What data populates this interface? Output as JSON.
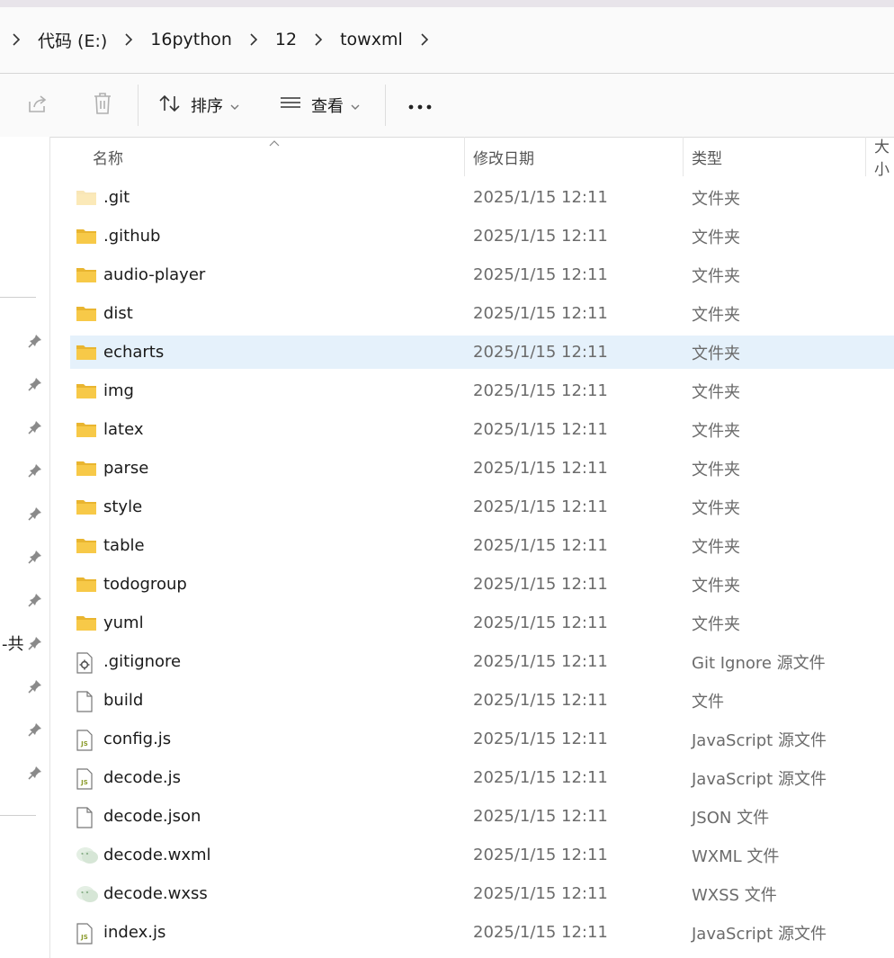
{
  "breadcrumb": {
    "items": [
      {
        "label": "代码 (E:)"
      },
      {
        "label": "16python"
      },
      {
        "label": "12"
      },
      {
        "label": "towxml"
      }
    ]
  },
  "toolbar": {
    "share_icon": "share-icon",
    "delete_icon": "trash-icon",
    "sort_label": "排序",
    "view_label": "查看",
    "more_icon": "more-icon"
  },
  "left_nav": {
    "partial_text": "-共",
    "pin_count": 11
  },
  "columns": {
    "name": "名称",
    "modified": "修改日期",
    "type": "类型",
    "size": "大小"
  },
  "files": [
    {
      "name": ".git",
      "date": "2025/1/15 12:11",
      "type": "文件夹",
      "icon": "folder-hidden"
    },
    {
      "name": ".github",
      "date": "2025/1/15 12:11",
      "type": "文件夹",
      "icon": "folder"
    },
    {
      "name": "audio-player",
      "date": "2025/1/15 12:11",
      "type": "文件夹",
      "icon": "folder"
    },
    {
      "name": "dist",
      "date": "2025/1/15 12:11",
      "type": "文件夹",
      "icon": "folder"
    },
    {
      "name": "echarts",
      "date": "2025/1/15 12:11",
      "type": "文件夹",
      "icon": "folder",
      "selected": true
    },
    {
      "name": "img",
      "date": "2025/1/15 12:11",
      "type": "文件夹",
      "icon": "folder"
    },
    {
      "name": "latex",
      "date": "2025/1/15 12:11",
      "type": "文件夹",
      "icon": "folder"
    },
    {
      "name": "parse",
      "date": "2025/1/15 12:11",
      "type": "文件夹",
      "icon": "folder"
    },
    {
      "name": "style",
      "date": "2025/1/15 12:11",
      "type": "文件夹",
      "icon": "folder"
    },
    {
      "name": "table",
      "date": "2025/1/15 12:11",
      "type": "文件夹",
      "icon": "folder"
    },
    {
      "name": "todogroup",
      "date": "2025/1/15 12:11",
      "type": "文件夹",
      "icon": "folder"
    },
    {
      "name": "yuml",
      "date": "2025/1/15 12:11",
      "type": "文件夹",
      "icon": "folder"
    },
    {
      "name": ".gitignore",
      "date": "2025/1/15 12:11",
      "type": "Git Ignore 源文件",
      "icon": "gear-file"
    },
    {
      "name": "build",
      "date": "2025/1/15 12:11",
      "type": "文件",
      "icon": "blank-file"
    },
    {
      "name": "config.js",
      "date": "2025/1/15 12:11",
      "type": "JavaScript 源文件",
      "icon": "js-file"
    },
    {
      "name": "decode.js",
      "date": "2025/1/15 12:11",
      "type": "JavaScript 源文件",
      "icon": "js-file"
    },
    {
      "name": "decode.json",
      "date": "2025/1/15 12:11",
      "type": "JSON 文件",
      "icon": "blank-file"
    },
    {
      "name": "decode.wxml",
      "date": "2025/1/15 12:11",
      "type": "WXML 文件",
      "icon": "wechat-file"
    },
    {
      "name": "decode.wxss",
      "date": "2025/1/15 12:11",
      "type": "WXSS 文件",
      "icon": "wechat-file"
    },
    {
      "name": "index.js",
      "date": "2025/1/15 12:11",
      "type": "JavaScript 源文件",
      "icon": "js-file"
    }
  ],
  "colors": {
    "folder": "#f7c948",
    "folder_dark": "#e9b530",
    "selected_row": "#e5f1fb",
    "js_label": "#8a9a2a"
  }
}
